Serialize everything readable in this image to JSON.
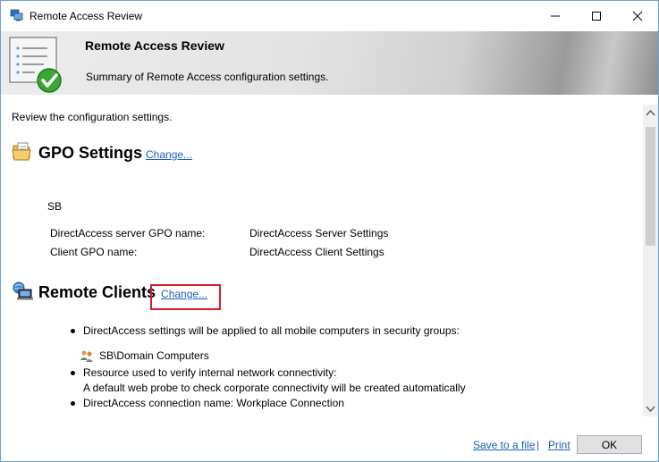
{
  "window": {
    "title": "Remote Access Review",
    "icon": "remote-access-icon",
    "controls": {
      "minimize": "—",
      "maximize": "☐",
      "close": "✕"
    }
  },
  "header": {
    "title": "Remote Access Review",
    "subtitle": "Summary of Remote Access configuration settings.",
    "icon": "checklist-check-icon"
  },
  "content": {
    "intro": "Review the configuration settings.",
    "gpo_section": {
      "title": "GPO Settings",
      "change_link": "Change...",
      "icon": "gpo-folder-icon",
      "domain": "SB",
      "rows": [
        {
          "label": "DirectAccess server GPO name:",
          "value": "DirectAccess Server Settings"
        },
        {
          "label": "Client GPO name:",
          "value": "DirectAccess Client Settings"
        }
      ]
    },
    "remote_clients_section": {
      "title": "Remote Clients",
      "change_link": "Change...",
      "icon": "remote-computer-icon",
      "bullets": [
        "DirectAccess settings will be applied to all mobile computers in security groups:",
        "Resource used to verify internal network connectivity:",
        "DirectAccess connection name: Workplace Connection"
      ],
      "group": "SB\\Domain Computers",
      "group_icon": "user-group-icon",
      "resource_note": "A default web probe to check corporate connectivity will be created automatically"
    }
  },
  "scrollbar": {
    "up": "^",
    "down": "v"
  },
  "footer": {
    "save_link": "Save to a file",
    "separator": "|",
    "print_link": "Print",
    "ok_label": "OK"
  },
  "colors": {
    "link": "#1a5fb4",
    "highlight_box": "#d11f2b"
  }
}
